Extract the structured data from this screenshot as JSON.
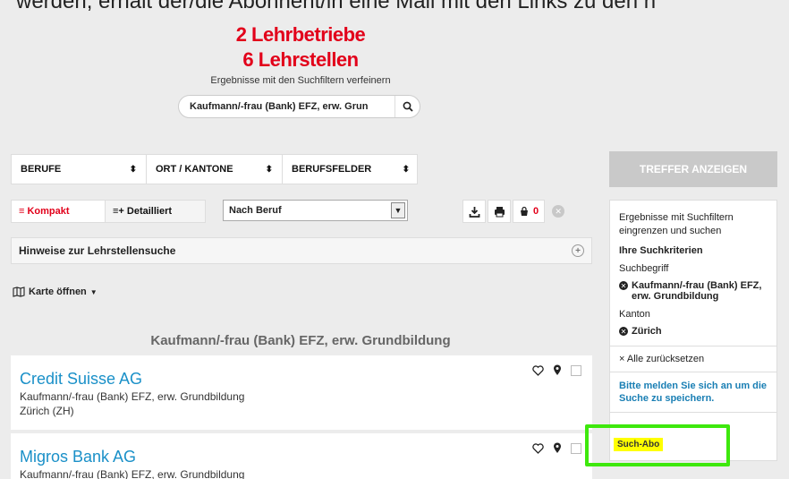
{
  "top_partial_text": "werden, erhält der/die Abonnent/in eine Mail mit den Links zu den n",
  "results": {
    "companies": "2 Lehrbetriebe",
    "positions": "6 Lehrstellen",
    "refine_text": "Ergebnisse mit den Suchfiltern verfeinern"
  },
  "search": {
    "value": "Kaufmann/-frau (Bank) EFZ, erw. Grun",
    "icon": "search-icon"
  },
  "filters": [
    {
      "label": "BERUFE"
    },
    {
      "label": "ORT / KANTONE"
    },
    {
      "label": "BERUFSFELDER"
    }
  ],
  "views": {
    "compact": "≡ Kompakt",
    "detailed": "≡+ Detailliert"
  },
  "sort": {
    "selected": "Nach Beruf"
  },
  "tools": {
    "bag_count": "0"
  },
  "hint": {
    "label": "Hinweise zur Lehrstellensuche"
  },
  "map": {
    "label": "Karte öffnen"
  },
  "group": {
    "title": "Kaufmann/-frau (Bank) EFZ, erw. Grundbildung"
  },
  "listings": [
    {
      "company": "Credit Suisse AG",
      "profession": "Kaufmann/-frau (Bank) EFZ, erw. Grundbildung",
      "location": "Zürich (ZH)"
    },
    {
      "company": "Migros Bank AG",
      "profession": "Kaufmann/-frau (Bank) EFZ, erw. Grundbildung",
      "location": ""
    }
  ],
  "sidebar": {
    "treffer_button": "TREFFER ANZEIGEN",
    "intro": "Ergebnisse mit Suchfiltern eingrenzen und suchen",
    "criteria_title": "Ihre Suchkriterien",
    "search_term_label": "Suchbegriff",
    "search_term_value": "Kaufmann/-frau (Bank) EFZ, erw. Grundbildung",
    "canton_label": "Kanton",
    "canton_value": "Zürich",
    "reset": "× Alle zurücksetzen",
    "login_prompt": "Bitte melden Sie sich an um die Suche zu speichern.",
    "abo": "Such-Abo"
  },
  "colors": {
    "accent_red": "#e2001a",
    "link_blue": "#1a90c8",
    "highlight_yellow": "#ffff00",
    "highlight_green": "#3ee80d"
  }
}
